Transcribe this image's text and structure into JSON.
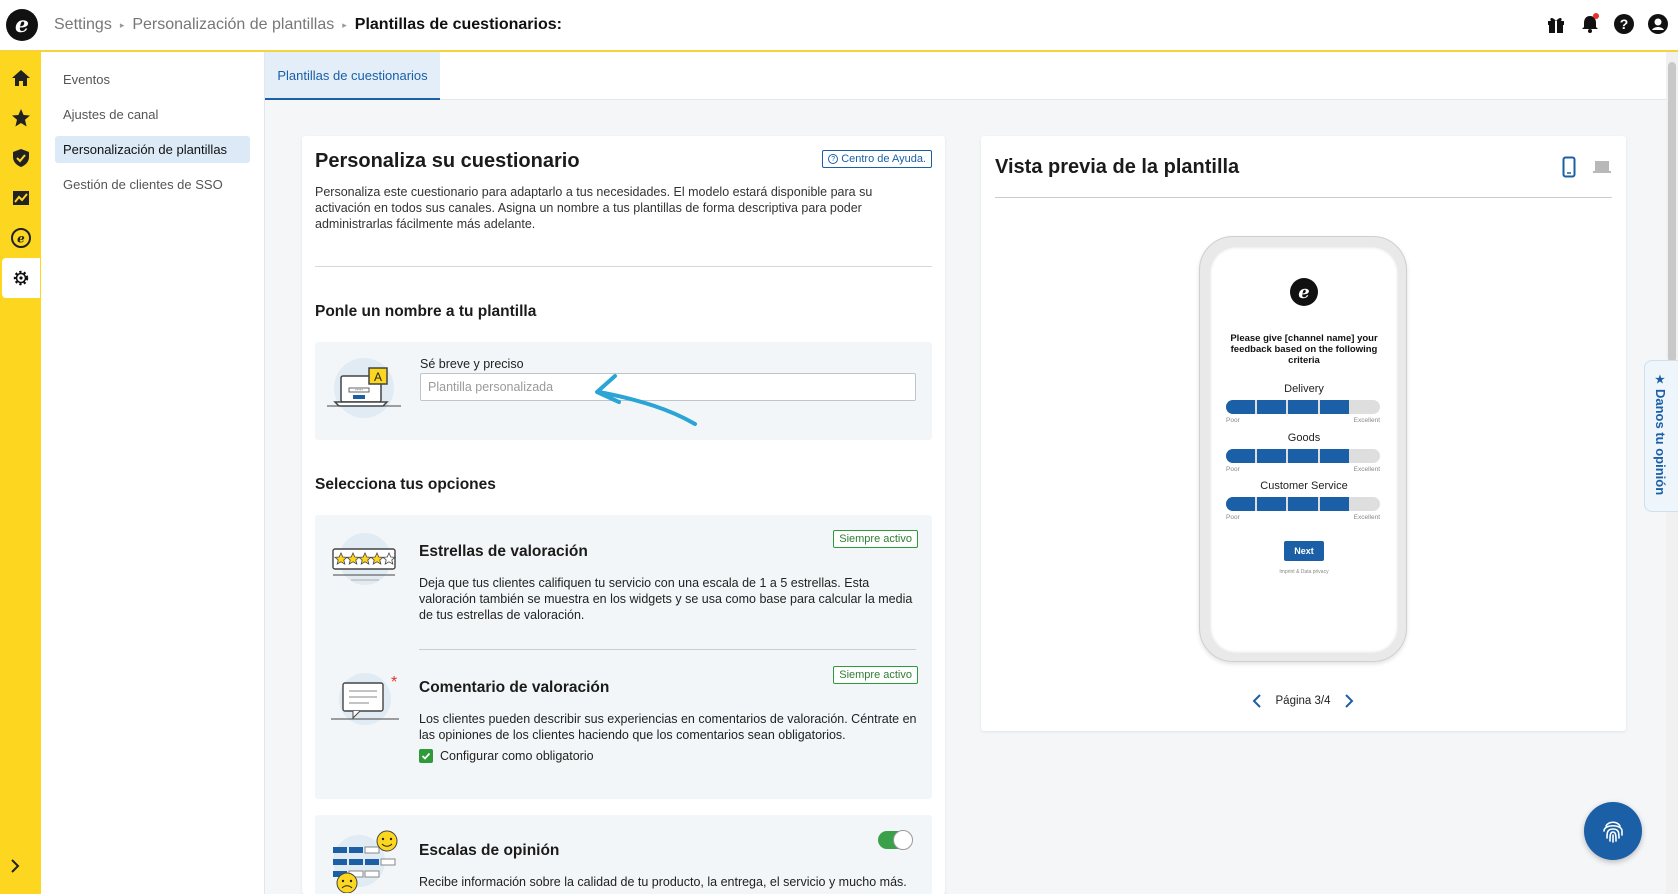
{
  "header": {
    "breadcrumb": [
      "Settings",
      "Personalización de plantillas"
    ],
    "current": "Plantillas de cuestionarios:"
  },
  "subnav": {
    "items": [
      {
        "label": "Eventos"
      },
      {
        "label": "Ajustes de canal"
      },
      {
        "label": "Personalización de plantillas"
      },
      {
        "label": "Gestión de clientes de SSO"
      }
    ]
  },
  "tabs": [
    {
      "label": "Plantillas de cuestionarios"
    }
  ],
  "customize": {
    "title": "Personaliza su cuestionario",
    "help_label": "Centro de Ayuda.",
    "description": "Personaliza este cuestionario para adaptarlo a tus necesidades. El modelo estará disponible para su activación en todos sus canales. Asigna un nombre a tus plantillas de forma descriptiva para poder administrarlas fácilmente más adelante.",
    "name_heading": "Ponle un nombre a tu plantilla",
    "name_field_label": "Sé breve y preciso",
    "name_placeholder": "Plantilla personalizada",
    "options_heading": "Selecciona tus opciones",
    "options": [
      {
        "title": "Estrellas de valoración",
        "badge": "Siempre activo",
        "description": "Deja que tus clientes califiquen tu servicio con una escala de 1 a 5 estrellas. Esta valoración también se muestra en los widgets y se usa como base para calcular la media de tus estrellas de valoración."
      },
      {
        "title": "Comentario de valoración",
        "badge": "Siempre activo",
        "description": "Los clientes pueden describir sus experiencias en comentarios de valoración. Céntrate en las opiniones de los clientes haciendo que los comentarios sean obligatorios.",
        "checkbox_label": "Configurar como obligatorio"
      },
      {
        "title": "Escalas de opinión",
        "description": "Recibe información sobre la calidad de tu producto, la entrega, el servicio y mucho más."
      }
    ]
  },
  "preview": {
    "title": "Vista previa de la plantilla",
    "question": "Please give [channel name] your feedback based on the following criteria",
    "criteria": [
      {
        "label": "Delivery",
        "level": 4
      },
      {
        "label": "Goods",
        "level": 4
      },
      {
        "label": "Customer Service",
        "level": 4
      }
    ],
    "scale_low": "Poor",
    "scale_high": "Excellent",
    "next_label": "Next",
    "footer": "Imprint & Data privacy",
    "page_label": "Página 3/4"
  },
  "feedback_tab": "Danos tu opinión",
  "colors": {
    "accent": "#1b5fa6",
    "rail": "#fdd71f",
    "success": "#2f9a3a"
  }
}
